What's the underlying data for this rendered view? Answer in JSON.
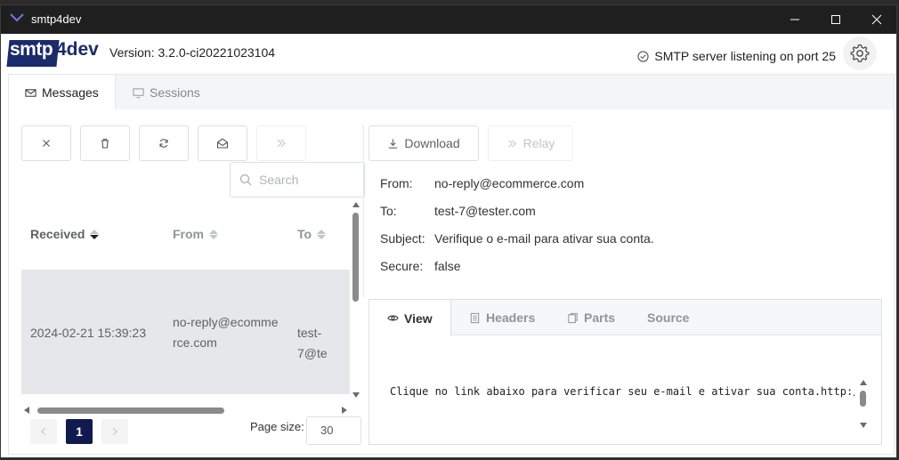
{
  "window": {
    "title": "smtp4dev"
  },
  "header": {
    "logo_left": "smtp",
    "logo_right": "4dev",
    "version": "Version: 3.2.0-ci20221023104",
    "status": "SMTP server listening on port 25"
  },
  "tabs": [
    {
      "label": "Messages",
      "icon": "envelope-icon",
      "active": true
    },
    {
      "label": "Sessions",
      "icon": "monitor-icon",
      "active": false
    }
  ],
  "toolbar": {
    "buttons": [
      "close-icon",
      "trash-icon",
      "refresh-icon",
      "envelope-open-icon",
      "chevron-double-right-icon"
    ]
  },
  "search": {
    "placeholder": "Search"
  },
  "table": {
    "columns": [
      {
        "label": "Received",
        "sort": "desc"
      },
      {
        "label": "From",
        "sort": "none"
      },
      {
        "label": "To",
        "sort": "none"
      }
    ],
    "rows": [
      {
        "received": "2024-02-21 15:39:23",
        "from_line1": "no-reply@ecomme",
        "from_line2": "rce.com",
        "to": "test-7@te"
      }
    ]
  },
  "pager": {
    "current": "1",
    "page_size_label": "Page size:",
    "page_size": "30"
  },
  "message": {
    "download_label": "Download",
    "relay_label": "Relay",
    "fields": [
      {
        "key": "From:",
        "value": "no-reply@ecommerce.com"
      },
      {
        "key": "To:",
        "value": "test-7@tester.com"
      },
      {
        "key": "Subject:",
        "value": "Verifique o e-mail para ativar sua conta."
      },
      {
        "key": "Secure:",
        "value": "false"
      }
    ],
    "view_tabs": [
      {
        "label": "View",
        "icon": "eye-icon",
        "active": true
      },
      {
        "label": "Headers",
        "icon": "document-icon",
        "active": false
      },
      {
        "label": "Parts",
        "icon": "copy-icon",
        "active": false
      },
      {
        "label": "Source",
        "icon": "",
        "active": false
      }
    ],
    "body": "Clique no link abaixo para verificar seu e-mail e ativar sua conta.http:/"
  }
}
